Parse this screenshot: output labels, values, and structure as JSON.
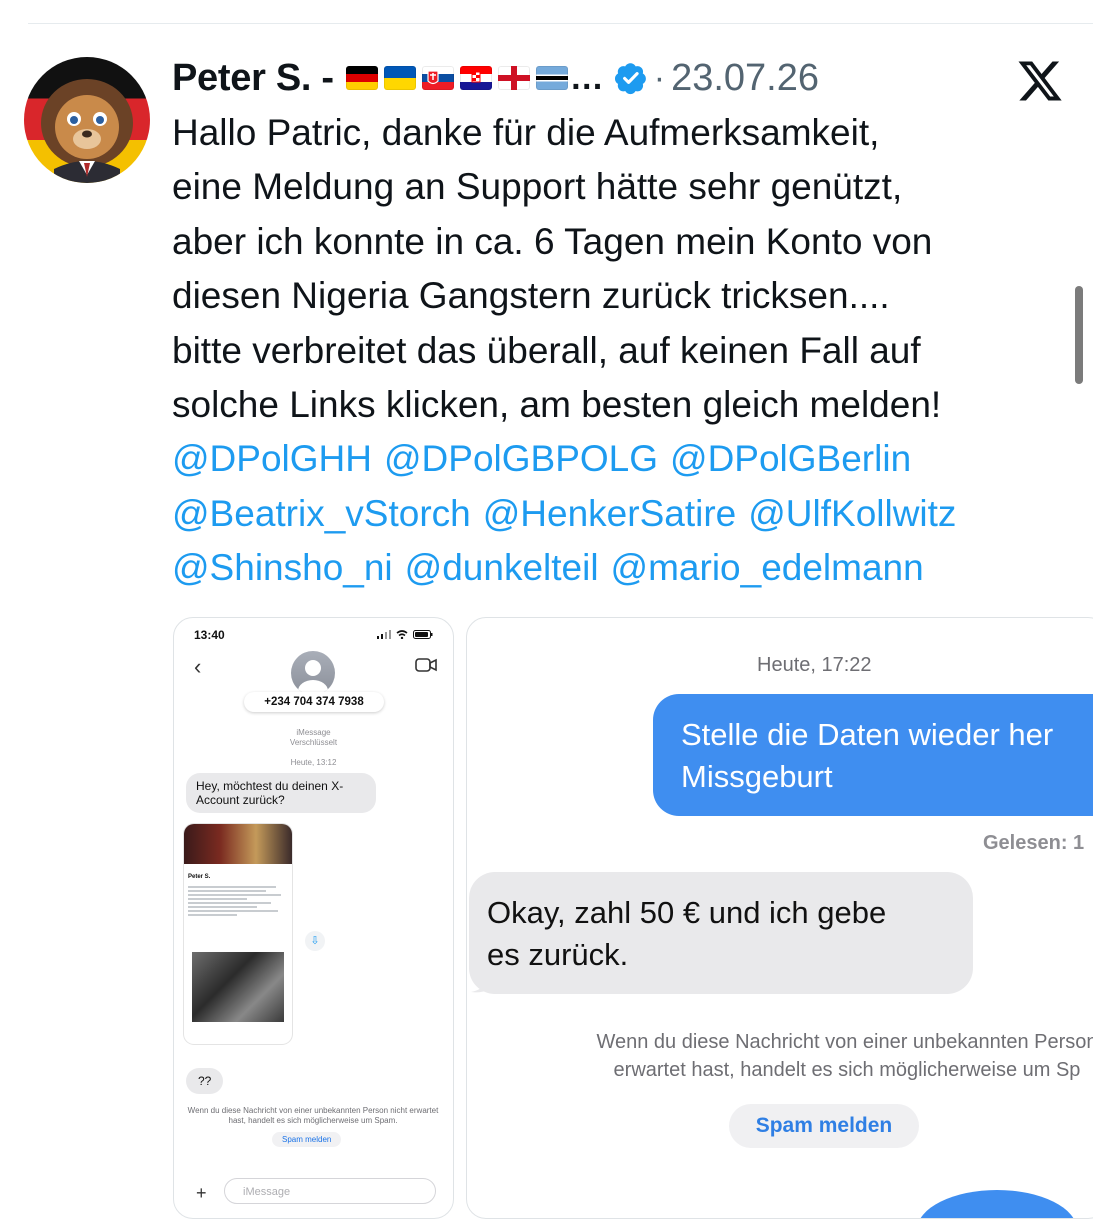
{
  "tweet": {
    "display_name": "Peter S. -",
    "flag_icons": [
      "germany-flag",
      "ukraine-flag",
      "slovakia-flag",
      "croatia-flag",
      "england-flag",
      "botswana-flag"
    ],
    "name_ellipsis": "…",
    "verified_icon": "verified-badge-icon",
    "separator": "·",
    "date": "23.07.26",
    "platform_icon": "x-logo-icon",
    "text_lines": [
      "Hallo Patric, danke für die Aufmerksamkeit,",
      "eine Meldung an Support hätte sehr genützt,",
      "aber ich konnte in ca. 6 Tagen mein Konto von",
      "diesen Nigeria Gangstern zurück tricksen....",
      "bitte verbreitet das überall, auf keinen Fall auf",
      "solche Links klicken, am besten gleich melden!"
    ],
    "mentions": [
      [
        "@DPolGHH",
        "@DPolGBPOLG",
        "@DPolGBerlin"
      ],
      [
        "@Beatrix_vStorch",
        "@HenkerSatire",
        "@UlfKollwitz"
      ],
      [
        "@Shinsho_ni",
        "@dunkelteil",
        "@mario_edelmann"
      ]
    ],
    "colors": {
      "link": "#1d9bf0",
      "text": "#0f1419",
      "meta": "#536471",
      "verified": "#1d9bf0"
    }
  },
  "media_left": {
    "status_time": "13:40",
    "phone_number": "+234 704 374 7938",
    "imessage_label": "iMessage",
    "encrypted_label": "Verschlüsselt",
    "time_label": "Heute, 13:12",
    "message_1": "Hey, möchtest du deinen X-Account zurück?",
    "screenshot_name": "Peter S.",
    "message_2": "??",
    "warning": "Wenn du diese Nachricht von einer unbekannten Person nicht erwartet hast, handelt es sich möglicherweise um Spam.",
    "spam_button": "Spam melden",
    "input_placeholder": "iMessage"
  },
  "media_right": {
    "time_label": "Heute, 17:22",
    "sent_line_1": "Stelle die Daten wieder her",
    "sent_line_2": "Missgeburt",
    "read_label": "Gelesen: 1",
    "received_line_1": "Okay, zahl 50 € und ich gebe",
    "received_line_2": "es zurück.",
    "warning_line_1": "Wenn du diese Nachricht von einer unbekannten Person",
    "warning_line_2": "erwartet hast, handelt es sich möglicherweise um Sp",
    "spam_button": "Spam melden",
    "colors": {
      "sent_bubble": "#3f8ef0",
      "received_bubble": "#e9e9eb",
      "spam_link": "#2f7fe4"
    }
  }
}
